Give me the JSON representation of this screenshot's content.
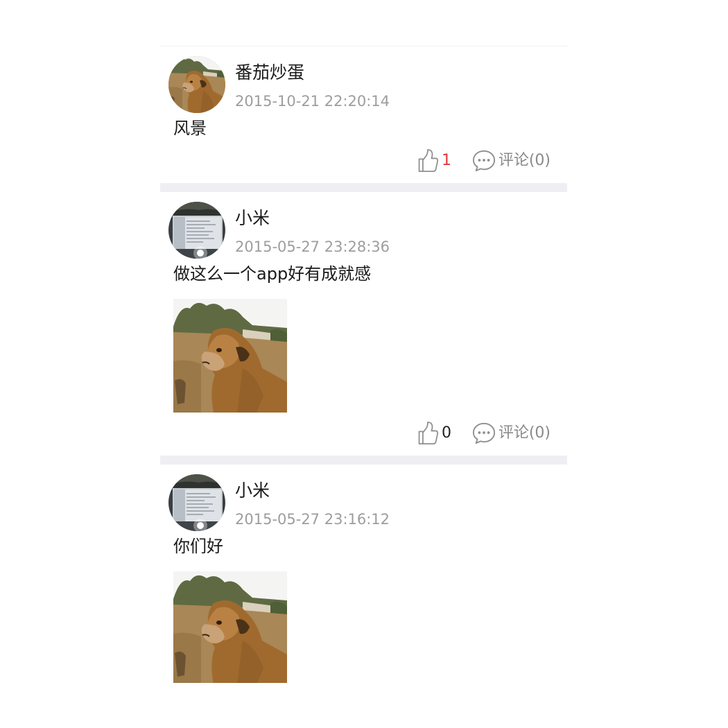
{
  "feed": {
    "posts": [
      {
        "username": "番茄炒蛋",
        "timestamp": "2015-10-21 22:20:14",
        "text": "风景",
        "avatar": "camel-photo",
        "has_image": false,
        "likes": "1",
        "liked": true,
        "comment_label": "评论(0)"
      },
      {
        "username": "小米",
        "timestamp": "2015-05-27 23:28:36",
        "text": "做这么一个app好有成就感",
        "avatar": "monitor-photo",
        "has_image": true,
        "image": "camel-photo",
        "likes": "0",
        "liked": false,
        "comment_label": "评论(0)"
      },
      {
        "username": "小米",
        "timestamp": "2015-05-27 23:16:12",
        "text": "你们好",
        "avatar": "monitor-photo",
        "has_image": true,
        "image": "camel-photo"
      }
    ]
  },
  "colors": {
    "like_active": "#e0393e",
    "like_inactive": "#222222",
    "secondary_text": "#9d9d9d",
    "separator": "#efeff3"
  },
  "icons": {
    "like": "thumbs-up-icon",
    "comment": "chat-bubble-icon"
  }
}
